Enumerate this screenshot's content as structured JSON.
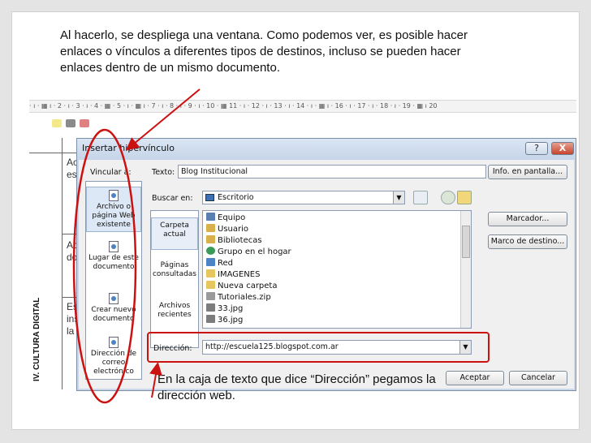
{
  "caption": "Al hacerlo, se despliega una ventana. Como podemos ver, es posible hacer enlaces o vínculos a diferentes tipos de destinos, incluso se pueden hacer enlaces dentro de un mismo documento.",
  "ruler_text": "· ı · ▦ ı · 2 · ı · 3 · ı · 4 · ▦ · 5 · ı · ▦ ı · 7 · ı · 8 · ı · 9 · ı · 10 · ▦ 11 · ı · 12 · ı · 13 · ı · 14 · ı · ▦ ı · 16 · ı · 17 · ı · 18 · ı · 19 · ▦ ı 20",
  "document": {
    "side_label": "IV. CULTURA DIGITAL",
    "fragments": [
      "Ac",
      "es",
      "Ac",
      "do",
      "Es",
      "ins",
      "la"
    ]
  },
  "dialog": {
    "title": "Insertar hipervínculo",
    "help": "?",
    "close": "X",
    "link_to_label": "Vincular a:",
    "text_label": "Texto:",
    "text_value": "Blog Institucional",
    "screen_info_button": "Info. en pantalla...",
    "search_label": "Buscar en:",
    "search_value": "Escritorio",
    "bookmark_button": "Marcador...",
    "target_frame_button": "Marco de destino...",
    "address_label": "Dirección:",
    "address_value": "http://escuela125.blogspot.com.ar",
    "ok_button": "Aceptar",
    "cancel_button": "Cancelar",
    "link_types": [
      {
        "label": "Archivo o página Web existente",
        "icon": "web-page-icon",
        "active": true
      },
      {
        "label": "Lugar de este documento",
        "icon": "document-place-icon",
        "active": false
      },
      {
        "label": "Crear nuevo documento",
        "icon": "new-document-icon",
        "active": false
      },
      {
        "label": "Dirección de correo electrónico",
        "icon": "email-icon",
        "active": false
      }
    ],
    "subnav": [
      {
        "label": "Carpeta actual",
        "active": true
      },
      {
        "label": "Páginas consultadas",
        "active": false
      },
      {
        "label": "Archivos recientes",
        "active": false
      }
    ],
    "files": [
      {
        "name": "Equipo",
        "icon": "computer-icon",
        "color": "#5a7fb0"
      },
      {
        "name": "Usuario",
        "icon": "user-folder-icon",
        "color": "#d9b04a"
      },
      {
        "name": "Bibliotecas",
        "icon": "library-icon",
        "color": "#d9b04a"
      },
      {
        "name": "Grupo en el hogar",
        "icon": "homegroup-icon",
        "color": "#3a9a5a"
      },
      {
        "name": "Red",
        "icon": "network-icon",
        "color": "#4b83c4"
      },
      {
        "name": "IMAGENES",
        "icon": "folder-icon",
        "color": "#e7c75d"
      },
      {
        "name": "Nueva carpeta",
        "icon": "folder-icon",
        "color": "#e7c75d"
      },
      {
        "name": "Tutoriales.zip",
        "icon": "zip-icon",
        "color": "#9a9a9a"
      },
      {
        "name": "33.jpg",
        "icon": "image-icon",
        "color": "#7c7c7c"
      },
      {
        "name": "36.jpg",
        "icon": "image-icon",
        "color": "#7c7c7c"
      }
    ]
  },
  "note": "En la caja de texto que dice “Dirección” pegamos la dirección web.",
  "colors": {
    "annotation": "#cc1111",
    "dialog_frame": "#c9d7e9"
  }
}
